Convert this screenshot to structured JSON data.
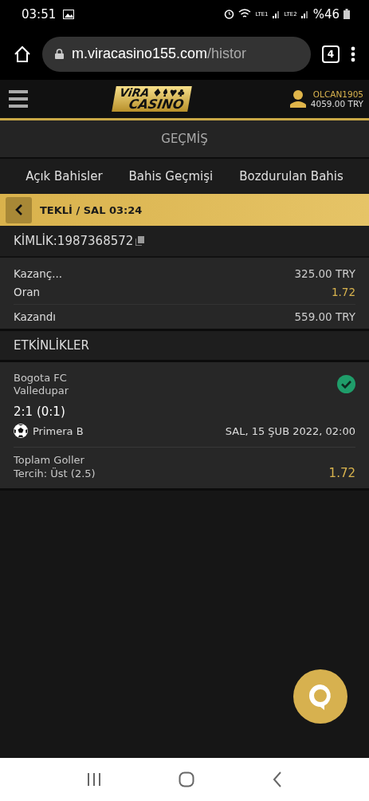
{
  "status_bar": {
    "time": "03:51",
    "network_1": "LTE1",
    "network_2": "LTE2",
    "battery": "%46"
  },
  "browser": {
    "url_host": "m.viracasino155.com",
    "url_path": "/histor",
    "tab_count": "4"
  },
  "header": {
    "logo_top": "ViRA",
    "logo_bottom": "CASINO",
    "username": "OLCAN1905",
    "balance": "4059.00 TRY"
  },
  "page_title": "GEÇMİŞ",
  "tabs": [
    {
      "label": "Açık Bahisler",
      "selected": false
    },
    {
      "label": "Bahis Geçmişi",
      "selected": false
    },
    {
      "label": "Bozdurulan Bahis",
      "selected": false
    }
  ],
  "bet_bar": {
    "title": "TEKLİ / SAL 03:24"
  },
  "id_row": {
    "label": "KİMLİK:",
    "value": "1987368572"
  },
  "summary": [
    {
      "label": "Kazanç...",
      "value": "325.00 TRY",
      "kind": "money"
    },
    {
      "label": "Oran",
      "value": "1.72",
      "kind": "odds"
    },
    {
      "label": "Kazandı",
      "value": "559.00 TRY",
      "kind": "money"
    }
  ],
  "events_title": "ETKİNLİKLER",
  "events": [
    {
      "home": "Bogota FC",
      "away": "Valledupar",
      "won": true,
      "score": "2:1 (0:1)",
      "league": "Primera B",
      "date": "SAL, 15 ŞUB 2022, 02:00",
      "market": "Toplam Goller",
      "pick": "Tercih: Üst (2.5)",
      "odds": "1.72"
    }
  ]
}
